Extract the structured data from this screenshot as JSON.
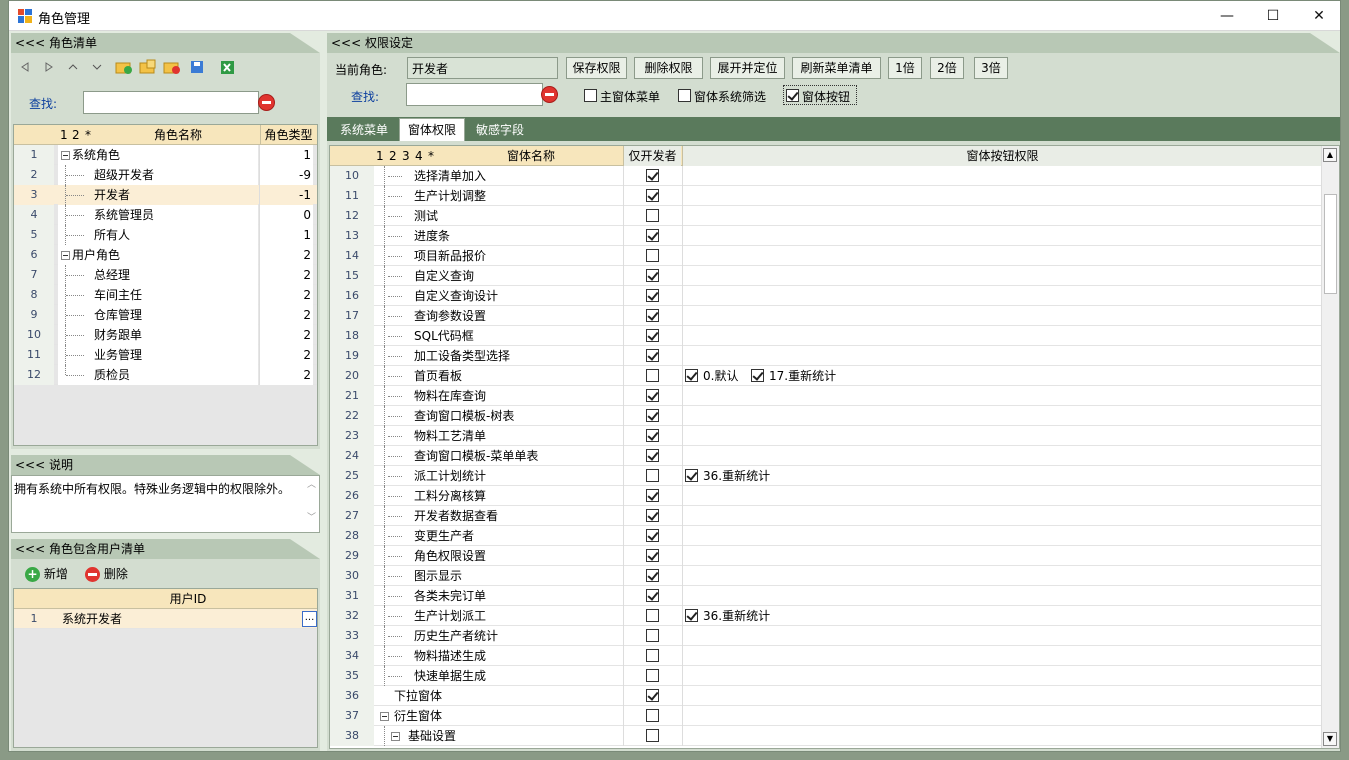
{
  "window": {
    "title": "角色管理",
    "minimize": "—",
    "maximize": "☐",
    "close": "✕"
  },
  "left": {
    "role_header": "<<< 角色清单",
    "search_label": "查找:",
    "search_value": "",
    "grid_head": {
      "c1": "1",
      "c2": "2",
      "c3": "*",
      "name": "角色名称",
      "type": "角色类型"
    },
    "roles": [
      {
        "no": "1",
        "name": "系统角色",
        "type": "1",
        "level": 0,
        "group": true
      },
      {
        "no": "2",
        "name": "超级开发者",
        "type": "-9",
        "level": 1
      },
      {
        "no": "3",
        "name": "开发者",
        "type": "-1",
        "level": 1,
        "selected": true
      },
      {
        "no": "4",
        "name": "系统管理员",
        "type": "0",
        "level": 1
      },
      {
        "no": "5",
        "name": "所有人",
        "type": "1",
        "level": 1
      },
      {
        "no": "6",
        "name": "用户角色",
        "type": "2",
        "level": 0,
        "group": true
      },
      {
        "no": "7",
        "name": "总经理",
        "type": "2",
        "level": 1
      },
      {
        "no": "8",
        "name": "车间主任",
        "type": "2",
        "level": 1
      },
      {
        "no": "9",
        "name": "仓库管理",
        "type": "2",
        "level": 1
      },
      {
        "no": "10",
        "name": "财务跟单",
        "type": "2",
        "level": 1
      },
      {
        "no": "11",
        "name": "业务管理",
        "type": "2",
        "level": 1
      },
      {
        "no": "12",
        "name": "质检员",
        "type": "2",
        "level": 1
      }
    ],
    "desc_header": "<<< 说明",
    "desc_text": "拥有系统中所有权限。特殊业务逻辑中的权限除外。",
    "users_header": "<<< 角色包含用户清单",
    "add_label": "新增",
    "delete_label": "删除",
    "users_col": "用户ID",
    "users": [
      {
        "no": "1",
        "id": "系统开发者"
      }
    ],
    "ellipsis": "..."
  },
  "right": {
    "header": "<<< 权限设定",
    "current_role_label": "当前角色:",
    "current_role": "开发者",
    "buttons": [
      "保存权限",
      "删除权限",
      "展开并定位",
      "刷新菜单清单",
      "1倍",
      "2倍",
      "3倍"
    ],
    "search_label": "查找:",
    "search_value": "",
    "filters": [
      {
        "label": "主窗体菜单",
        "checked": false
      },
      {
        "label": "窗体系统筛选",
        "checked": false
      },
      {
        "label": "窗体按钮",
        "checked": true
      }
    ],
    "tabs": [
      "系统菜单",
      "窗体权限",
      "敏感字段"
    ],
    "active_tab": 1,
    "grid_head": {
      "c1": "1",
      "c2": "2",
      "c3": "3",
      "c4": "4",
      "c5": "*",
      "name": "窗体名称",
      "devonly": "仅开发者",
      "btns": "窗体按钮权限"
    },
    "rows": [
      {
        "no": "10",
        "name": "选择清单加入",
        "dev": true,
        "btns": []
      },
      {
        "no": "11",
        "name": "生产计划调整",
        "dev": true,
        "btns": []
      },
      {
        "no": "12",
        "name": "测试",
        "dev": false,
        "btns": []
      },
      {
        "no": "13",
        "name": "进度条",
        "dev": true,
        "btns": []
      },
      {
        "no": "14",
        "name": "项目新品报价",
        "dev": false,
        "btns": []
      },
      {
        "no": "15",
        "name": "自定义查询",
        "dev": true,
        "btns": []
      },
      {
        "no": "16",
        "name": "自定义查询设计",
        "dev": true,
        "btns": []
      },
      {
        "no": "17",
        "name": "查询参数设置",
        "dev": true,
        "btns": []
      },
      {
        "no": "18",
        "name": "SQL代码框",
        "dev": true,
        "btns": []
      },
      {
        "no": "19",
        "name": "加工设备类型选择",
        "dev": true,
        "btns": []
      },
      {
        "no": "20",
        "name": "首页看板",
        "dev": false,
        "btns": [
          "0.默认",
          "17.重新统计"
        ]
      },
      {
        "no": "21",
        "name": "物料在库查询",
        "dev": true,
        "btns": []
      },
      {
        "no": "22",
        "name": "查询窗口模板-树表",
        "dev": true,
        "btns": []
      },
      {
        "no": "23",
        "name": "物料工艺清单",
        "dev": true,
        "btns": []
      },
      {
        "no": "24",
        "name": "查询窗口模板-菜单单表",
        "dev": true,
        "btns": []
      },
      {
        "no": "25",
        "name": "派工计划统计",
        "dev": false,
        "btns": [
          "36.重新统计"
        ]
      },
      {
        "no": "26",
        "name": "工料分离核算",
        "dev": true,
        "btns": []
      },
      {
        "no": "27",
        "name": "开发者数据查看",
        "dev": true,
        "btns": []
      },
      {
        "no": "28",
        "name": "变更生产者",
        "dev": true,
        "btns": []
      },
      {
        "no": "29",
        "name": "角色权限设置",
        "dev": true,
        "btns": []
      },
      {
        "no": "30",
        "name": "图示显示",
        "dev": true,
        "btns": []
      },
      {
        "no": "31",
        "name": "各类未完订单",
        "dev": true,
        "btns": []
      },
      {
        "no": "32",
        "name": "生产计划派工",
        "dev": false,
        "btns": [
          "36.重新统计"
        ]
      },
      {
        "no": "33",
        "name": "历史生产者统计",
        "dev": false,
        "btns": []
      },
      {
        "no": "34",
        "name": "物料描述生成",
        "dev": false,
        "btns": []
      },
      {
        "no": "35",
        "name": "快速单据生成",
        "dev": false,
        "btns": []
      },
      {
        "no": "36",
        "name": "下拉窗体",
        "dev": true,
        "btns": [],
        "level": 0
      },
      {
        "no": "37",
        "name": "衍生窗体",
        "dev": false,
        "btns": [],
        "level": 0,
        "group": true
      },
      {
        "no": "38",
        "name": "基础设置",
        "dev": false,
        "btns": [],
        "level": 1,
        "group": true
      }
    ]
  }
}
